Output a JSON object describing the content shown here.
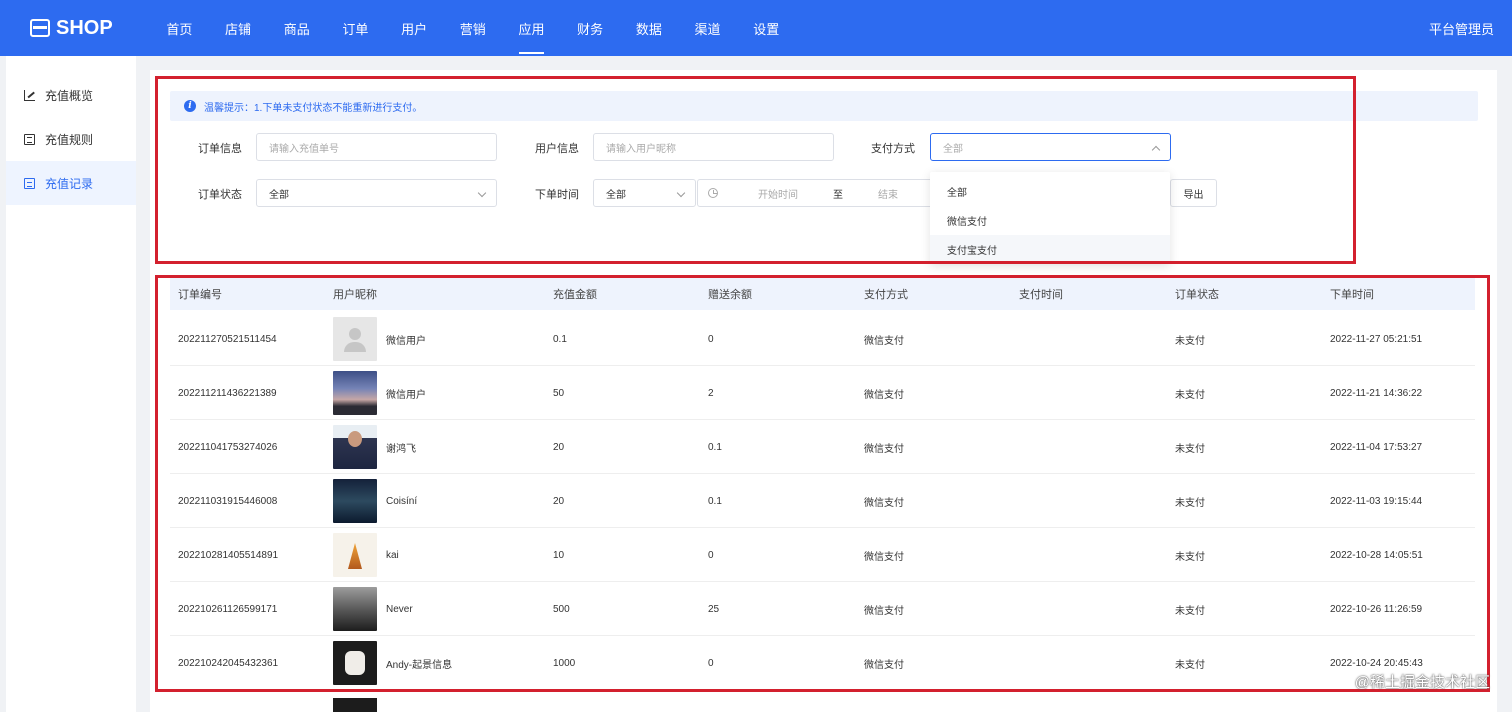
{
  "header": {
    "brand": "SHOP",
    "nav": [
      "首页",
      "店铺",
      "商品",
      "订单",
      "用户",
      "营销",
      "应用",
      "财务",
      "数据",
      "渠道",
      "设置"
    ],
    "active_nav": "应用",
    "admin": "平台管理员"
  },
  "sidebar": {
    "items": [
      {
        "label": "充值概览",
        "icon": "chart-line-icon"
      },
      {
        "label": "充值规则",
        "icon": "rules-list-icon"
      },
      {
        "label": "充值记录",
        "icon": "record-doc-icon"
      }
    ],
    "active": "充值记录"
  },
  "tip": {
    "text": "温馨提示：1.下单未支付状态不能重新进行支付。"
  },
  "filters": {
    "order_info_label": "订单信息",
    "order_info_placeholder": "请输入充值单号",
    "user_info_label": "用户信息",
    "user_info_placeholder": "请输入用户昵称",
    "pay_method_label": "支付方式",
    "pay_method_value": "全部",
    "order_status_label": "订单状态",
    "order_status_value": "全部",
    "order_time_label": "下单时间",
    "order_time_range_value": "全部",
    "start_placeholder": "开始时间",
    "range_separator": "至",
    "end_placeholder": "结束",
    "export_label": "导出"
  },
  "pay_dropdown": {
    "options": [
      "全部",
      "微信支付",
      "支付宝支付"
    ],
    "hovered": "支付宝支付"
  },
  "table": {
    "columns": [
      "订单编号",
      "用户昵称",
      "充值金额",
      "赠送余额",
      "支付方式",
      "支付时间",
      "订单状态",
      "下单时间"
    ],
    "rows": [
      {
        "order_no": "202211270521511454",
        "nickname": "微信用户",
        "amount": "0.1",
        "bonus": "0",
        "pay_method": "微信支付",
        "pay_time": "",
        "status": "未支付",
        "created": "2022-11-27 05:21:51"
      },
      {
        "order_no": "202211211436221389",
        "nickname": "微信用户",
        "amount": "50",
        "bonus": "2",
        "pay_method": "微信支付",
        "pay_time": "",
        "status": "未支付",
        "created": "2022-11-21 14:36:22"
      },
      {
        "order_no": "202211041753274026",
        "nickname": "谢鸿飞",
        "amount": "20",
        "bonus": "0.1",
        "pay_method": "微信支付",
        "pay_time": "",
        "status": "未支付",
        "created": "2022-11-04 17:53:27"
      },
      {
        "order_no": "202211031915446008",
        "nickname": "Coisíní",
        "amount": "20",
        "bonus": "0.1",
        "pay_method": "微信支付",
        "pay_time": "",
        "status": "未支付",
        "created": "2022-11-03 19:15:44"
      },
      {
        "order_no": "202210281405514891",
        "nickname": "kai",
        "amount": "10",
        "bonus": "0",
        "pay_method": "微信支付",
        "pay_time": "",
        "status": "未支付",
        "created": "2022-10-28 14:05:51"
      },
      {
        "order_no": "202210261126599171",
        "nickname": "Never",
        "amount": "500",
        "bonus": "25",
        "pay_method": "微信支付",
        "pay_time": "",
        "status": "未支付",
        "created": "2022-10-26 11:26:59"
      },
      {
        "order_no": "202210242045432361",
        "nickname": "Andy-起景信息",
        "amount": "1000",
        "bonus": "0",
        "pay_method": "微信支付",
        "pay_time": "",
        "status": "未支付",
        "created": "2022-10-24 20:45:43"
      }
    ]
  },
  "watermark": "@稀土掘金技术社区",
  "colors": {
    "primary": "#2d6bf0",
    "annotation_red": "#d3202e",
    "tip_bg": "#eef3fd"
  }
}
